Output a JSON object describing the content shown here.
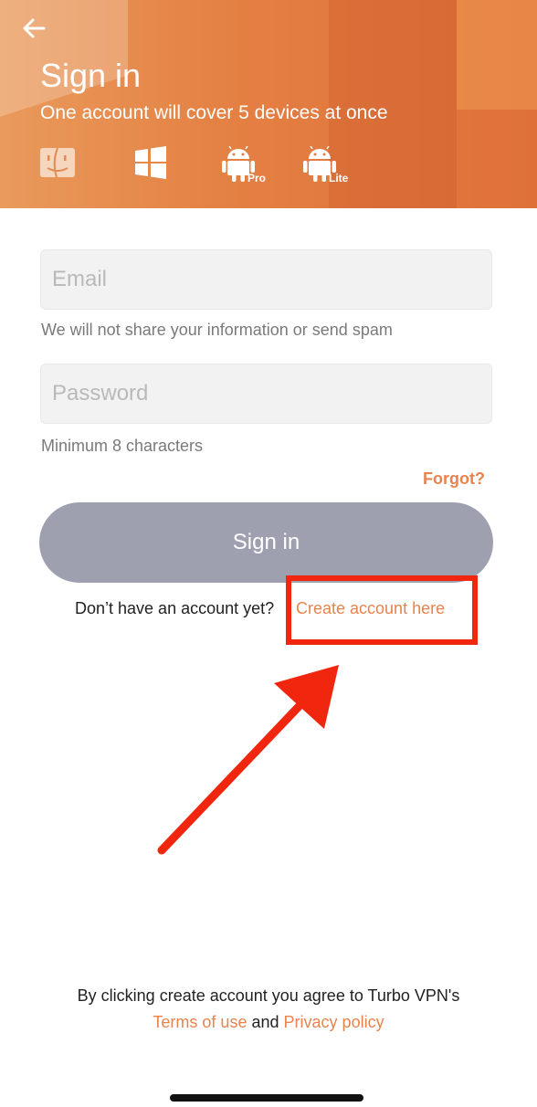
{
  "header": {
    "title": "Sign in",
    "subtitle": "One account will cover 5 devices at once",
    "back_icon": "arrow-left-icon",
    "platforms": [
      {
        "icon": "mac-finder-icon",
        "tag": ""
      },
      {
        "icon": "windows-icon",
        "tag": ""
      },
      {
        "icon": "android-icon",
        "tag": "Pro"
      },
      {
        "icon": "android-icon",
        "tag": "Lite"
      }
    ],
    "colors": {
      "gradient_start": "#e99a5c",
      "gradient_end": "#df7039"
    }
  },
  "form": {
    "email_placeholder": "Email",
    "email_hint": "We will not share your information or send spam",
    "password_placeholder": "Password",
    "password_hint": "Minimum 8 characters",
    "forgot_label": "Forgot?",
    "signin_label": "Sign in",
    "signin_button_color": "#9ea0b0"
  },
  "account": {
    "prompt": "Don’t have an account yet?",
    "create_link": "Create account here"
  },
  "annotation": {
    "highlight_color": "#f1260f",
    "arrow_icon": "red-arrow-icon"
  },
  "footer": {
    "line1": "By clicking create account you agree to Turbo VPN's",
    "terms_label": "Terms of use",
    "and_label": "and",
    "privacy_label": "Privacy policy"
  },
  "accent_color": "#e8834d"
}
